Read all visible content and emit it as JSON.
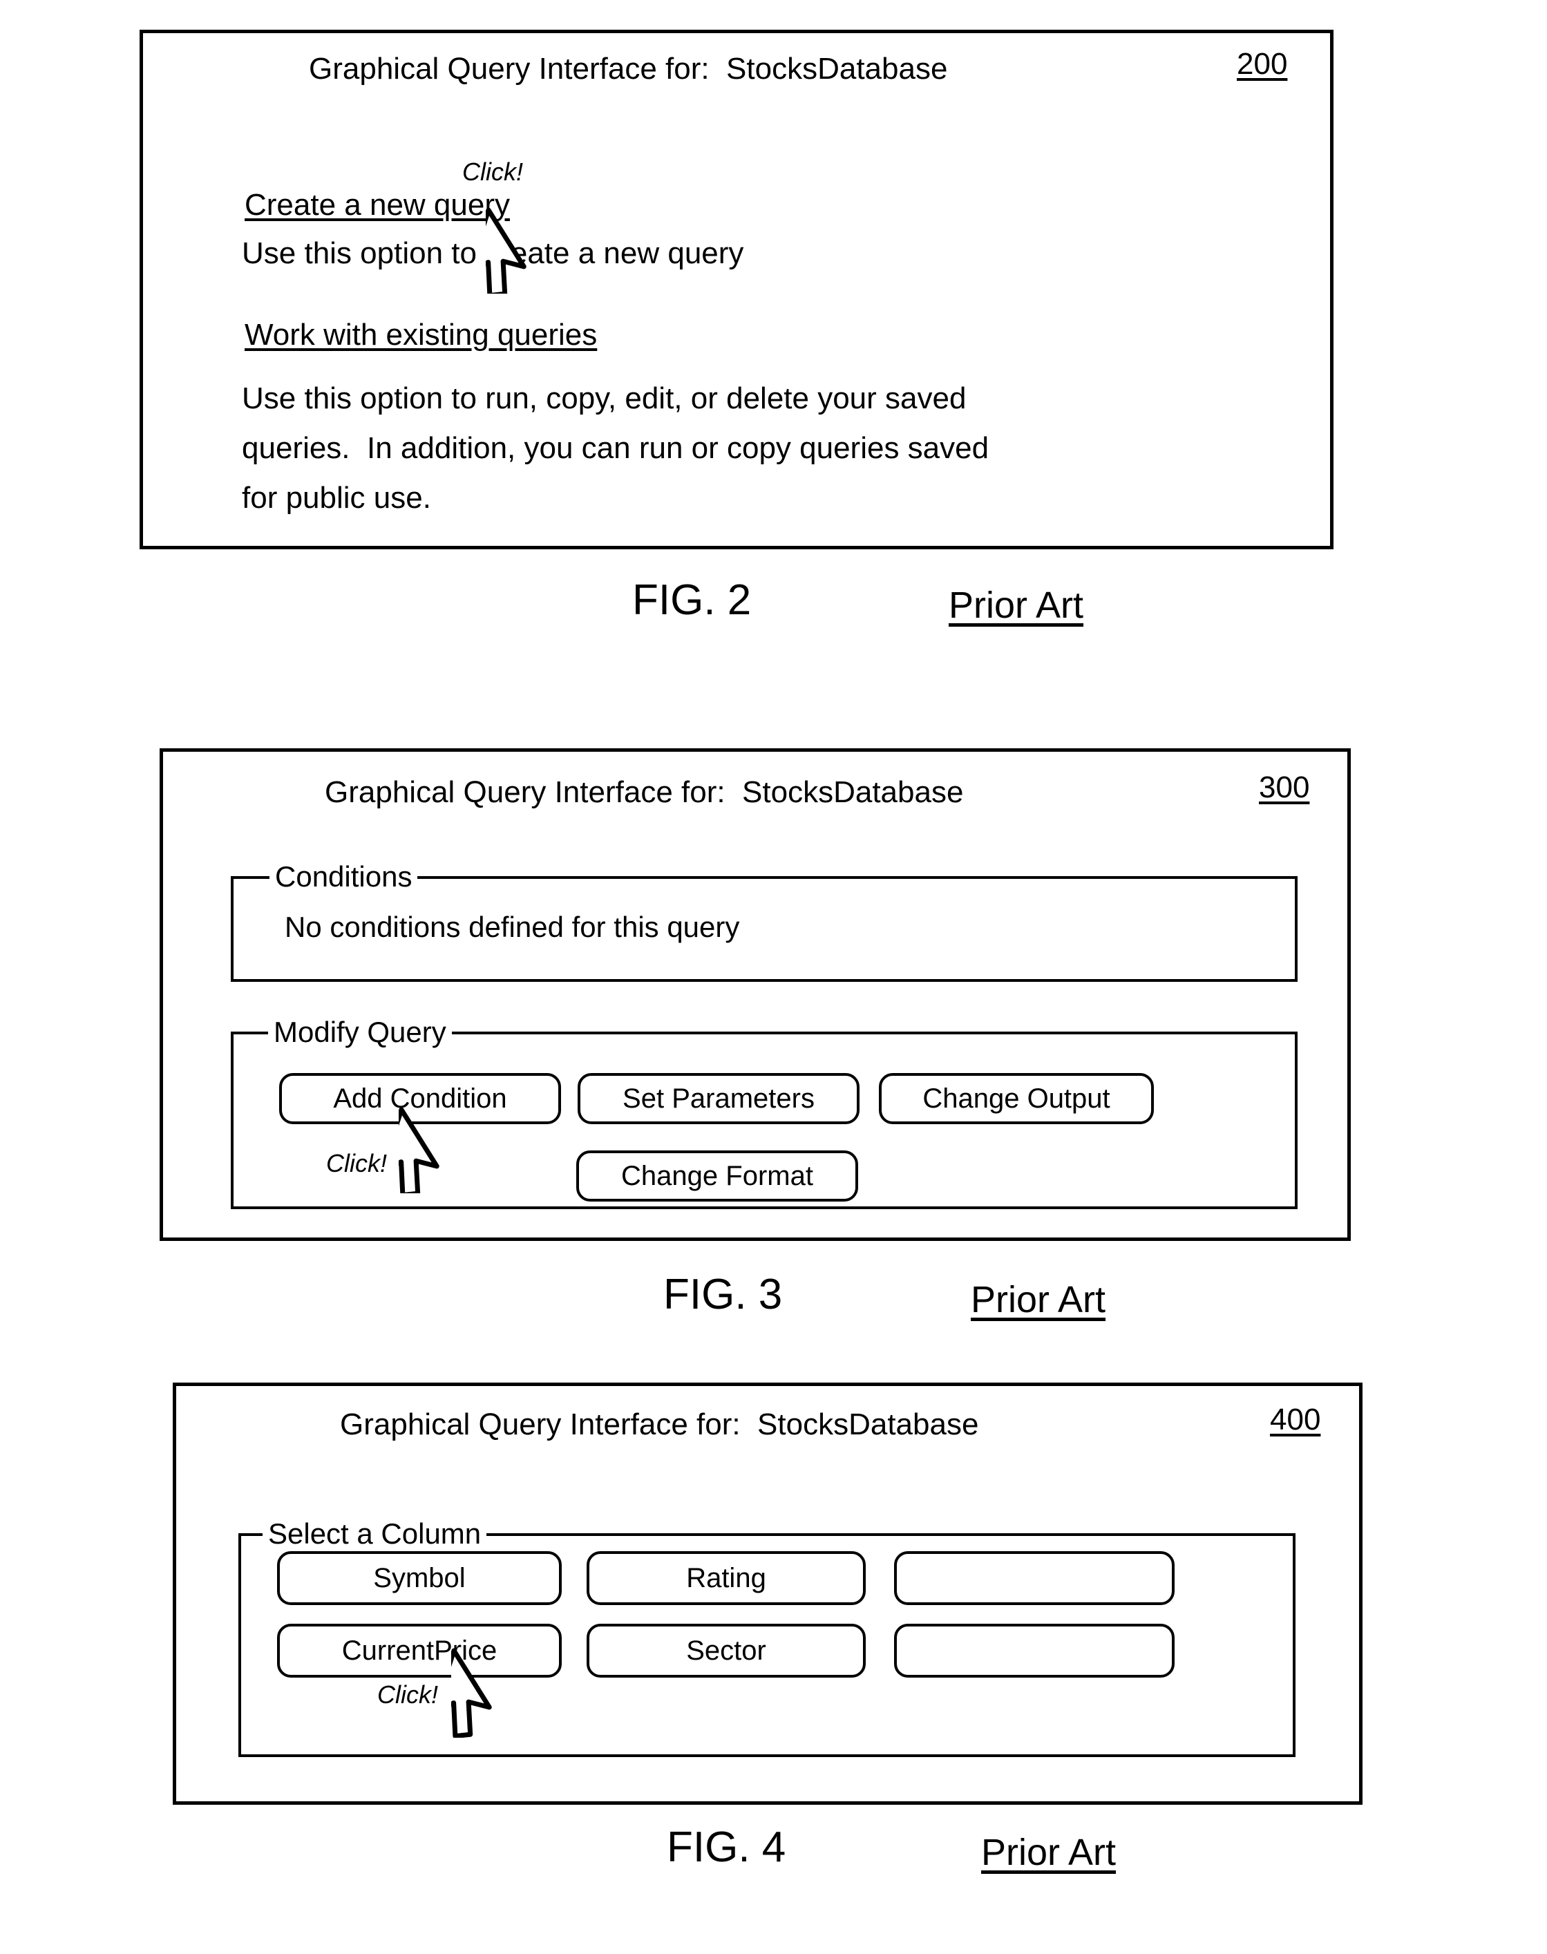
{
  "figures": [
    {
      "id": "fig2",
      "window_title": "Graphical Query Interface for:  StocksDatabase",
      "reference_numeral": "200",
      "options": [
        {
          "link_label": "Create a new query",
          "description": "Use this option to create a new query",
          "click_annotation": "Click!"
        },
        {
          "link_label": "Work with existing queries",
          "description_lines": [
            "Use this option to run, copy, edit, or delete your saved",
            "queries.  In addition, you can run or copy queries saved",
            "for public use."
          ]
        }
      ],
      "caption": "FIG. 2",
      "caption_note": "Prior Art"
    },
    {
      "id": "fig3",
      "window_title": "Graphical Query Interface for:  StocksDatabase",
      "reference_numeral": "300",
      "conditions_group": {
        "legend": "Conditions",
        "body_text": "No conditions defined for this query"
      },
      "modify_group": {
        "legend": "Modify Query",
        "buttons_row1": [
          "Add Condition",
          "Set Parameters",
          "Change Output"
        ],
        "buttons_row2": [
          "Change Format"
        ],
        "click_annotation": "Click!"
      },
      "caption": "FIG. 3",
      "caption_note": "Prior Art"
    },
    {
      "id": "fig4",
      "window_title": "Graphical Query Interface for:  StocksDatabase",
      "reference_numeral": "400",
      "select_column_group": {
        "legend": "Select a Column",
        "buttons_row1": [
          "Symbol",
          "Rating",
          ""
        ],
        "buttons_row2": [
          "CurrentPrice",
          "Sector",
          ""
        ],
        "click_annotation": "Click!"
      },
      "caption": "FIG. 4",
      "caption_note": "Prior Art"
    }
  ],
  "colors": {
    "ink": "#000000",
    "paper": "#ffffff"
  }
}
